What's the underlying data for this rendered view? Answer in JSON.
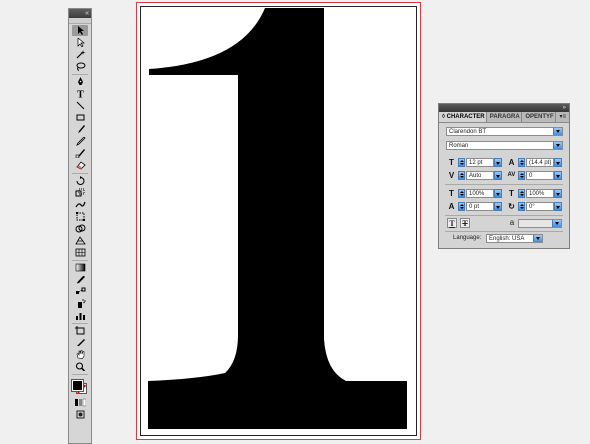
{
  "toolbox": {
    "collapse_glyph": "«",
    "tools": [
      {
        "name": "selection-tool",
        "icon": "arrow-black",
        "selected": true
      },
      {
        "name": "direct-selection-tool",
        "icon": "arrow-white",
        "selected": false
      },
      {
        "name": "magic-wand-tool",
        "icon": "wand",
        "selected": false
      },
      {
        "name": "lasso-tool",
        "icon": "lasso",
        "selected": false
      },
      {
        "name": "pen-tool",
        "icon": "pen",
        "selected": false
      },
      {
        "name": "type-tool",
        "icon": "T",
        "selected": false
      },
      {
        "name": "line-segment-tool",
        "icon": "line",
        "selected": false
      },
      {
        "name": "rectangle-tool",
        "icon": "rect",
        "selected": false
      },
      {
        "name": "paintbrush-tool",
        "icon": "brush",
        "selected": false
      },
      {
        "name": "pencil-tool",
        "icon": "pencil",
        "selected": false
      },
      {
        "name": "blob-brush-tool",
        "icon": "blob",
        "selected": false
      },
      {
        "name": "eraser-tool",
        "icon": "eraser",
        "selected": false
      },
      {
        "name": "rotate-tool",
        "icon": "rotate",
        "selected": false
      },
      {
        "name": "scale-tool",
        "icon": "scale",
        "selected": false
      },
      {
        "name": "warp-tool",
        "icon": "warp",
        "selected": false
      },
      {
        "name": "free-transform-tool",
        "icon": "transform",
        "selected": false
      },
      {
        "name": "shape-builder-tool",
        "icon": "builder",
        "selected": false
      },
      {
        "name": "perspective-grid-tool",
        "icon": "perspective",
        "selected": false
      },
      {
        "name": "mesh-tool",
        "icon": "mesh",
        "selected": false
      },
      {
        "name": "gradient-tool",
        "icon": "gradient",
        "selected": false
      },
      {
        "name": "eyedropper-tool",
        "icon": "eyedropper",
        "selected": false
      },
      {
        "name": "blend-tool",
        "icon": "blend",
        "selected": false
      },
      {
        "name": "symbol-sprayer-tool",
        "icon": "sprayer",
        "selected": false
      },
      {
        "name": "column-graph-tool",
        "icon": "graph",
        "selected": false
      },
      {
        "name": "artboard-tool",
        "icon": "artboard",
        "selected": false
      },
      {
        "name": "slice-tool",
        "icon": "slice",
        "selected": false
      },
      {
        "name": "hand-tool",
        "icon": "hand",
        "selected": false
      },
      {
        "name": "zoom-tool",
        "icon": "zoom",
        "selected": false
      }
    ],
    "fill_color": "#000000",
    "stroke_color": "none"
  },
  "document": {
    "glyph": "1",
    "glyph_color": "#000000",
    "artboard_border_color": "#e4373f"
  },
  "character_panel": {
    "panel_glyph": "»",
    "tabs": [
      {
        "label": "◊ CHARACTER",
        "active": true
      },
      {
        "label": "PARAGRA",
        "active": false
      },
      {
        "label": "OPENTYF",
        "active": false
      }
    ],
    "menu_glyph": "▾≡",
    "font_family": "Clarendon BT",
    "font_style": "Roman",
    "font_size": "12 pt",
    "leading": "(14.4 pt)",
    "kerning": "Auto",
    "tracking": "0",
    "vertical_scale": "100%",
    "horizontal_scale": "100%",
    "baseline_shift": "0 pt",
    "character_rotation": "0°",
    "language_label": "Language:",
    "language": "English: USA",
    "icons": {
      "font_size": "T",
      "leading": "A",
      "kerning": "V",
      "tracking": "AV",
      "vertical_scale": "T",
      "horizontal_scale": "T",
      "baseline_shift": "A",
      "rotation": "↻",
      "antialias": "a"
    },
    "underline_glyph": "T",
    "strikethrough_glyph": "T"
  }
}
